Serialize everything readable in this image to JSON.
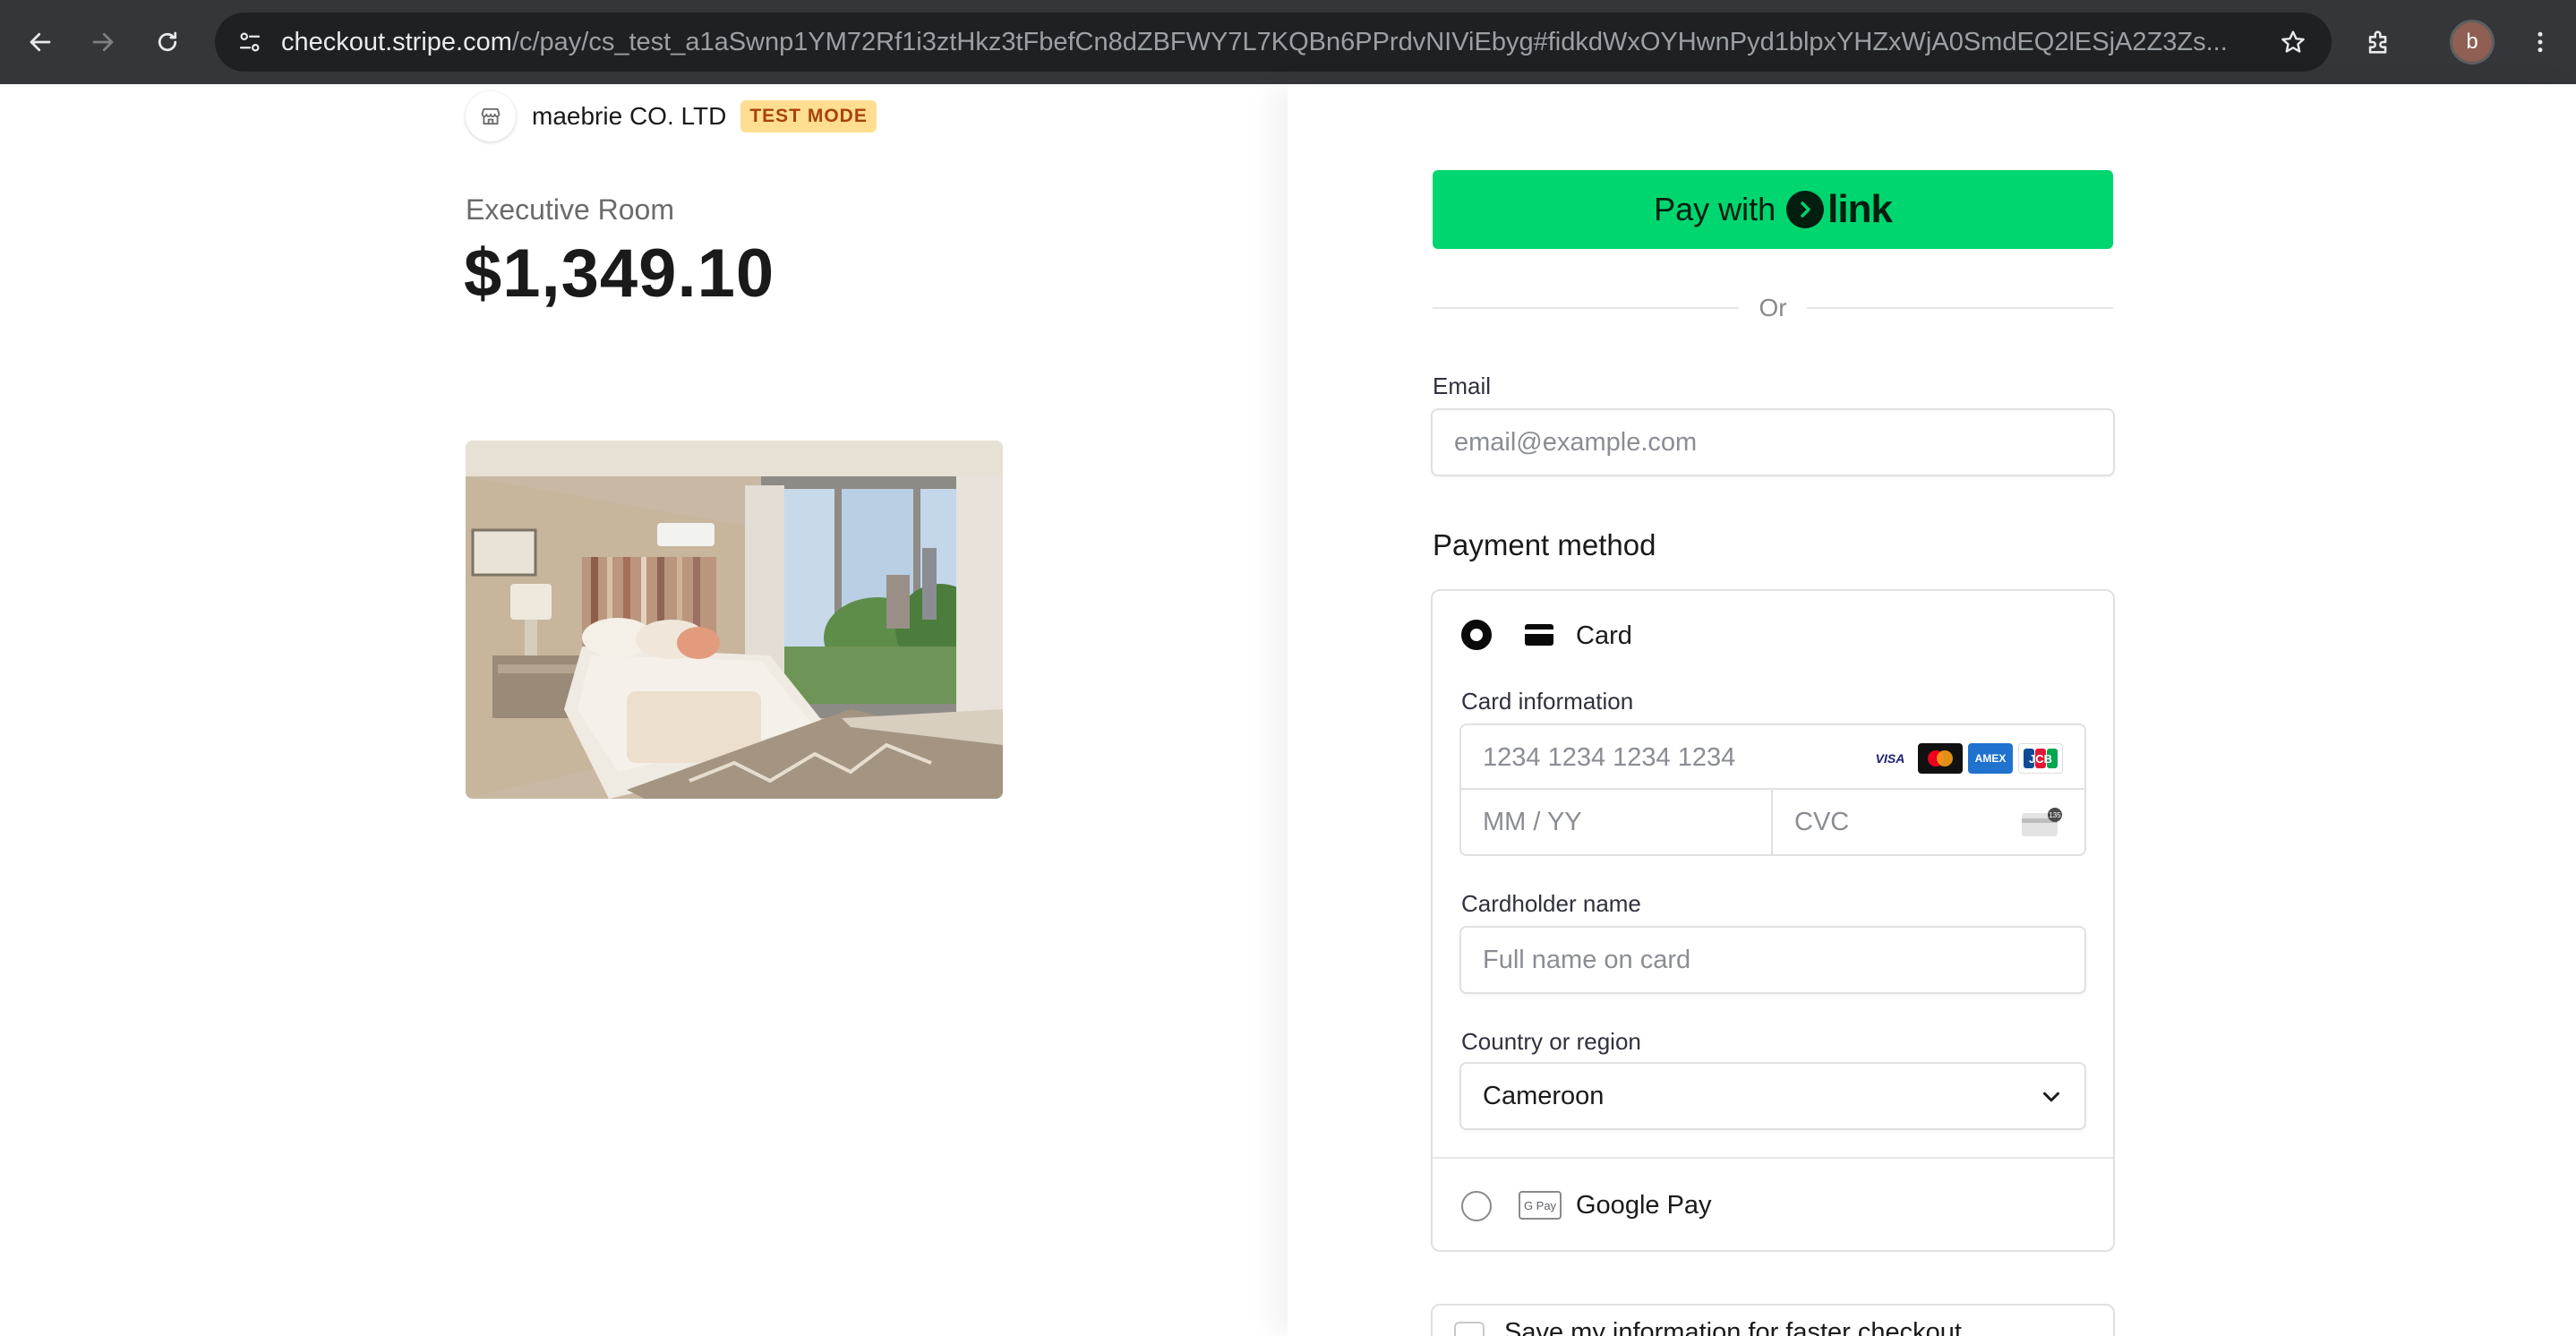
{
  "browser": {
    "url_domain": "checkout.stripe.com",
    "url_path": "/c/pay/cs_test_a1aSwnp1YM72Rf1i3ztHkz3tFbefCn8dZBFWY7L7KQBn6PPrdvNIViEbyg#fidkdWxOYHwnPyd1blpxYHZxWjA0SmdEQ2lESjA2Z3Zs...",
    "profile_initial": "b",
    "icons": [
      "back-arrow-icon",
      "forward-arrow-icon",
      "reload-icon",
      "site-info-icon",
      "star-icon",
      "extensions-icon",
      "kebab-menu-icon"
    ]
  },
  "summary": {
    "merchant_name": "maebrie CO. LTD",
    "badge": "TEST MODE",
    "product_name": "Executive Room",
    "price": "$1,349.10",
    "badge_colors": {
      "background": "#ffde92",
      "text": "#a8410b"
    }
  },
  "payment": {
    "link_button": {
      "prefix": "Pay with",
      "brand": "link",
      "color": "#00d66f"
    },
    "divider_text": "Or",
    "email": {
      "label": "Email",
      "placeholder": "email@example.com"
    },
    "method_title": "Payment method",
    "card_option": {
      "label": "Card",
      "selected": true
    },
    "card_info": {
      "label": "Card information",
      "number_placeholder": "1234 1234 1234 1234",
      "expiry_placeholder": "MM / YY",
      "cvc_placeholder": "CVC",
      "brands": [
        "VISA",
        "mastercard",
        "AMEX",
        "JCB"
      ]
    },
    "cardholder": {
      "label": "Cardholder name",
      "placeholder": "Full name on card"
    },
    "country": {
      "label": "Country or region",
      "value": "Cameroon"
    },
    "google_pay": {
      "label": "Google Pay",
      "icon_text": "G Pay",
      "selected": false
    },
    "save_info": {
      "label": "Save my information for faster checkout"
    }
  }
}
